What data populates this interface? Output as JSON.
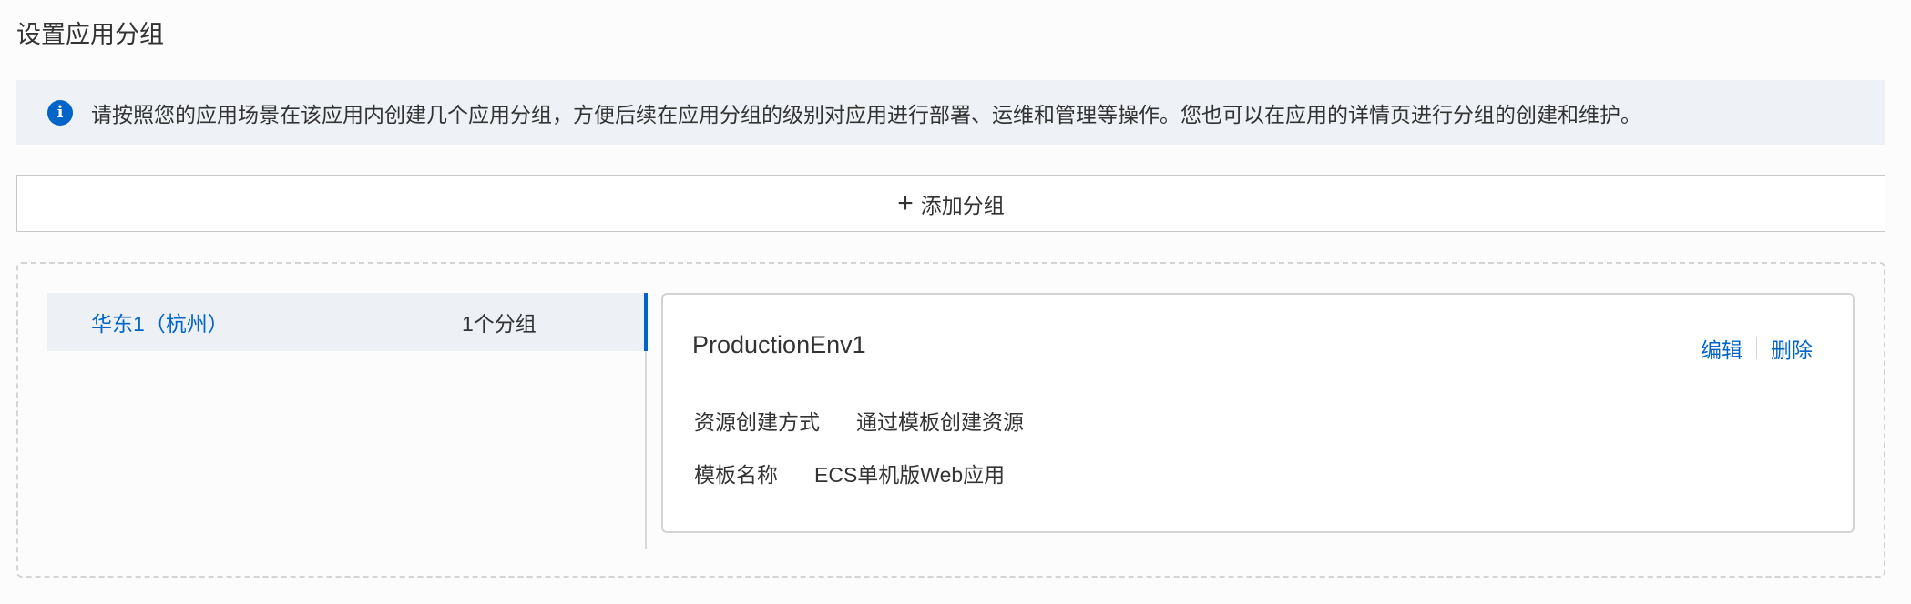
{
  "page": {
    "title": "设置应用分组"
  },
  "notice": {
    "icon": "info-icon",
    "text": "请按照您的应用场景在该应用内创建几个应用分组，方便后续在应用分组的级别对应用进行部署、运维和管理等操作。您也可以在应用的详情页进行分组的创建和维护。"
  },
  "add_group": {
    "icon": "plus-icon",
    "label": "添加分组"
  },
  "regions": [
    {
      "name": "华东1（杭州）",
      "count_label": "1个分组"
    }
  ],
  "group": {
    "name": "ProductionEnv1",
    "edit_label": "编辑",
    "delete_label": "删除",
    "fields": [
      {
        "label": "资源创建方式",
        "value": "通过模板创建资源"
      },
      {
        "label": "模板名称",
        "value": "ECS单机版Web应用"
      }
    ]
  },
  "colors": {
    "accent": "#0064c8",
    "notice_bg": "#eef1f5",
    "selected_bg": "#edf0f5"
  }
}
